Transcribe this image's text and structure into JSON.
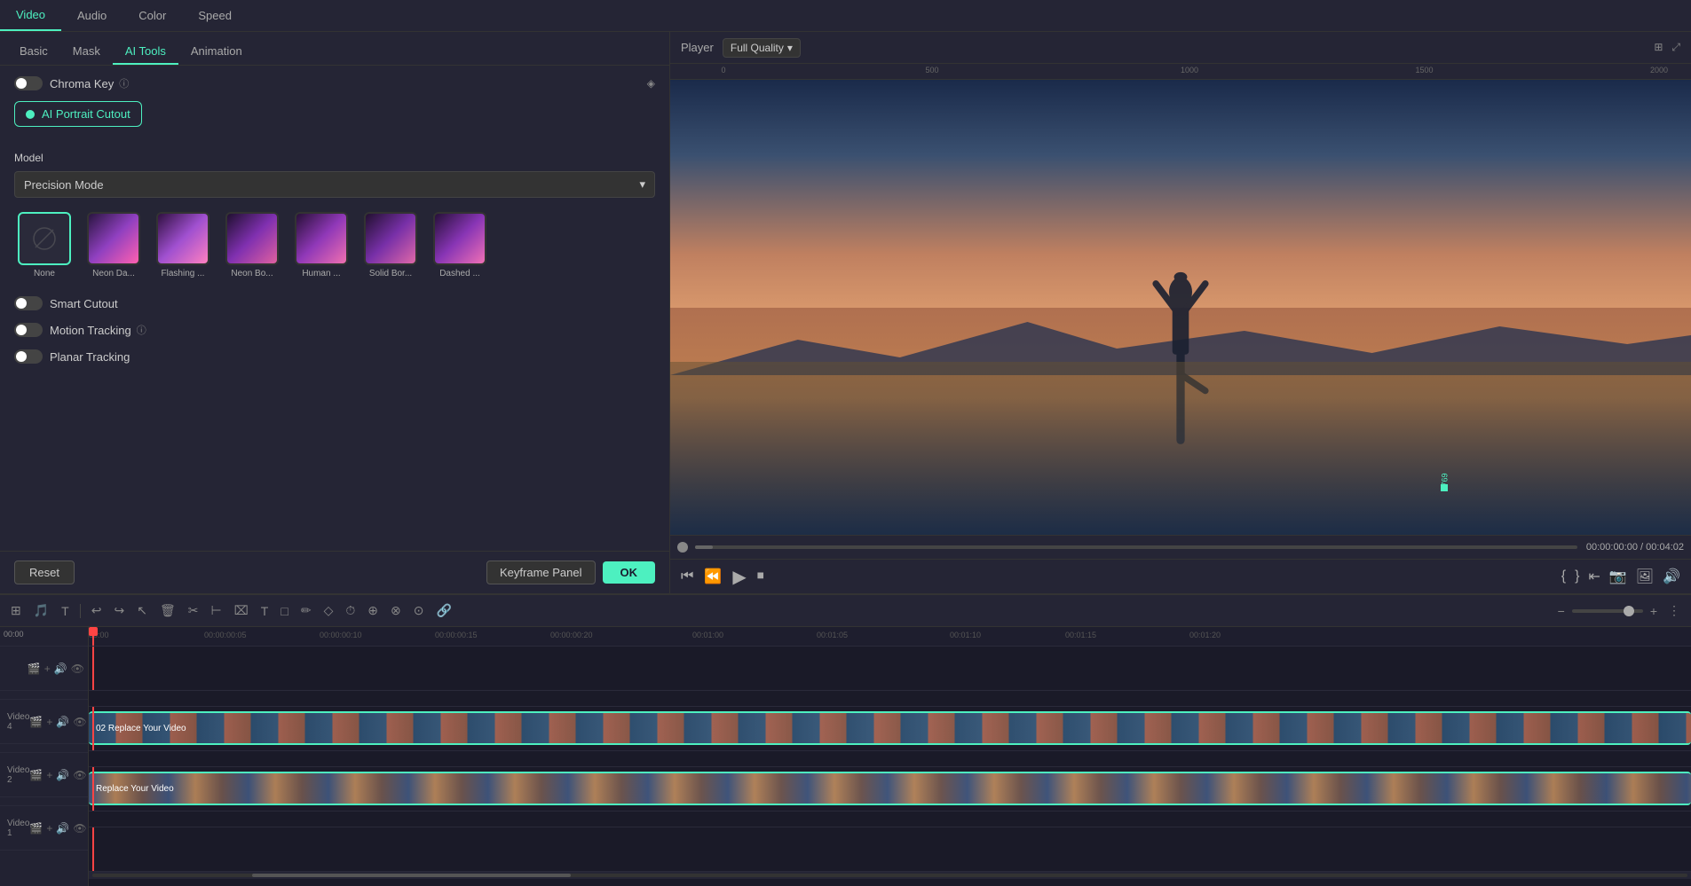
{
  "topTabs": {
    "tabs": [
      {
        "label": "Video",
        "active": true
      },
      {
        "label": "Audio",
        "active": false
      },
      {
        "label": "Color",
        "active": false
      },
      {
        "label": "Speed",
        "active": false
      }
    ]
  },
  "subTabs": {
    "tabs": [
      {
        "label": "Basic",
        "active": false
      },
      {
        "label": "Mask",
        "active": false
      },
      {
        "label": "AI Tools",
        "active": true
      },
      {
        "label": "Animation",
        "active": false
      }
    ]
  },
  "panel": {
    "chromaKey": {
      "label": "Chroma Key",
      "on": false
    },
    "aiPortrait": {
      "label": "AI Portrait Cutout",
      "on": true
    },
    "modelSection": {
      "label": "Model"
    },
    "modelValue": "Precision Mode",
    "pinIcon": "◈",
    "infoIcon": "ⓘ",
    "presets": [
      {
        "label": "None",
        "type": "none"
      },
      {
        "label": "Neon Da...",
        "type": "thumb"
      },
      {
        "label": "Flashing ...",
        "type": "thumb"
      },
      {
        "label": "Neon Bo...",
        "type": "thumb"
      },
      {
        "label": "Human ...",
        "type": "thumb"
      },
      {
        "label": "Solid Bor...",
        "type": "thumb"
      },
      {
        "label": "Dashed ...",
        "type": "thumb"
      }
    ],
    "smartCutout": {
      "label": "Smart Cutout",
      "on": false
    },
    "motionTracking": {
      "label": "Motion Tracking",
      "on": false,
      "hasInfo": true
    },
    "planarTracking": {
      "label": "Planar Tracking",
      "on": false
    },
    "buttons": {
      "reset": "Reset",
      "keyframePanel": "Keyframe Panel",
      "ok": "OK"
    }
  },
  "player": {
    "label": "Player",
    "quality": "Full Quality",
    "timecode": "00:00:00:00",
    "duration": "00:04:02",
    "rulerMarks": [
      "0",
      "500",
      "1000",
      "1500",
      "2000"
    ]
  },
  "timeline": {
    "tracks": [
      {
        "label": "Video 4",
        "clipLabel": "02 Replace Your Video"
      },
      {
        "label": "Video 2",
        "clipLabel": "Replace Your Video"
      },
      {
        "label": "Video 1",
        "clipLabel": ""
      }
    ],
    "timeMarks": [
      "00:00",
      "00:00:00:05",
      "00:00:00:10",
      "00:00:00:15",
      "00:00:00:20",
      "00:01:00",
      "00:01:05",
      "00:01:10",
      "00:01:15",
      "00:01:20"
    ],
    "zoomLevel": "zoom"
  }
}
